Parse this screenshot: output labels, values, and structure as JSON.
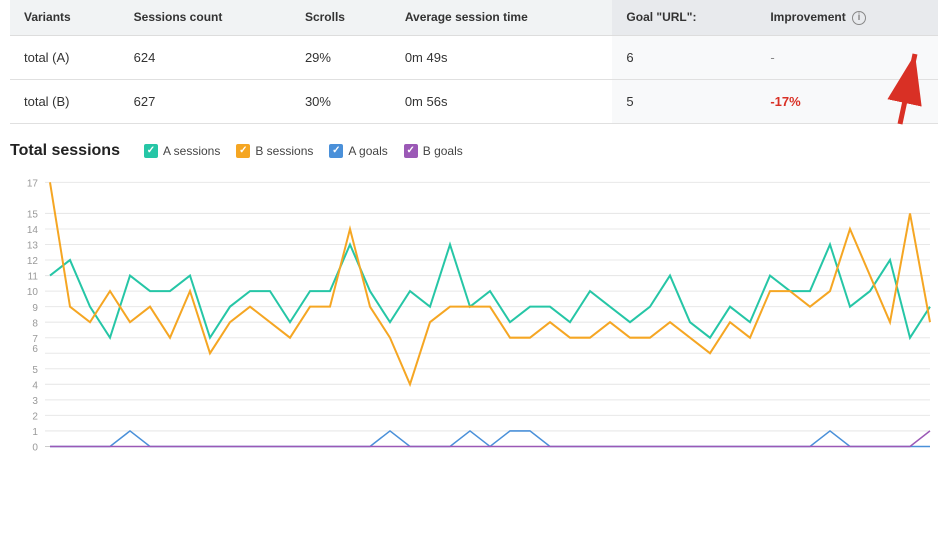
{
  "table": {
    "headers": [
      "Variants",
      "Sessions count",
      "Scrolls",
      "Average session time",
      "Goal \"URL\":",
      "Improvement"
    ],
    "rows": [
      {
        "variant": "total (A)",
        "sessions_count": "624",
        "scrolls": "29%",
        "avg_session_time": "0m 49s",
        "goal_url": "6",
        "improvement": "-",
        "improvement_type": "dash"
      },
      {
        "variant": "total (B)",
        "sessions_count": "627",
        "scrolls": "30%",
        "avg_session_time": "0m 56s",
        "goal_url": "5",
        "improvement": "-17%",
        "improvement_type": "negative"
      }
    ]
  },
  "chart": {
    "title": "Total sessions",
    "legend": [
      {
        "label": "A sessions",
        "color": "#26c6a6",
        "type": "check"
      },
      {
        "label": "B sessions",
        "color": "#f5a623",
        "type": "check"
      },
      {
        "label": "A goals",
        "color": "#4a90d9",
        "type": "check"
      },
      {
        "label": "B goals",
        "color": "#9b59b6",
        "type": "check"
      }
    ],
    "y_axis_labels": [
      "0",
      "2",
      "3",
      "5",
      "7",
      "8",
      "9",
      "10",
      "11",
      "12",
      "13",
      "14",
      "15",
      "17"
    ],
    "y_max": 17
  },
  "icons": {
    "info": "i",
    "check": "✓"
  }
}
